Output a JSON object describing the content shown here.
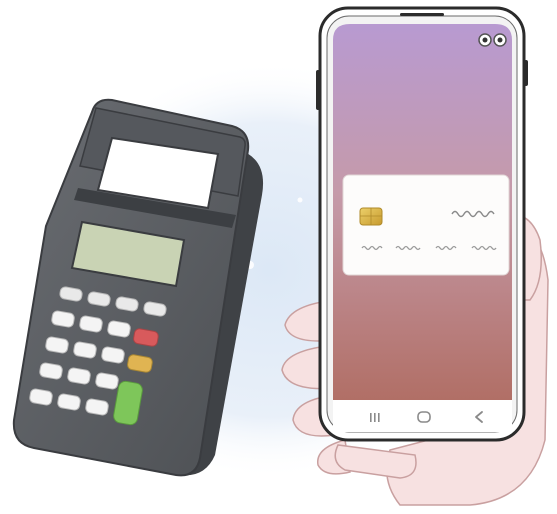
{
  "illustration": {
    "subject": "contactless-payment",
    "objects": [
      "payment-terminal",
      "smartphone",
      "hand"
    ]
  },
  "phone": {
    "navbar_icons": [
      "recent-apps-icon",
      "home-icon",
      "back-icon"
    ],
    "nav_glyphs": {
      "recent": "III",
      "home": "○",
      "back": "<"
    },
    "card": {
      "chip": "card-chip-icon"
    }
  },
  "terminal": {
    "keypad_rows": 4,
    "special_keys": [
      "red-key",
      "yellow-key",
      "green-key"
    ]
  },
  "colors": {
    "terminal_body": "#5b5e63",
    "terminal_dark": "#3f4246",
    "lcd_screen": "#c9d3b4",
    "key_red": "#d85a5c",
    "key_yellow": "#e0b452",
    "key_green": "#7ec65a",
    "screen_top": "#b79ad0",
    "screen_bottom": "#b6786c",
    "phone_frame": "#2b2b2b",
    "skin": "#f6dede",
    "glow": "#dfe9f6",
    "card": "#fdfcfb",
    "chip": "#d9b545"
  }
}
